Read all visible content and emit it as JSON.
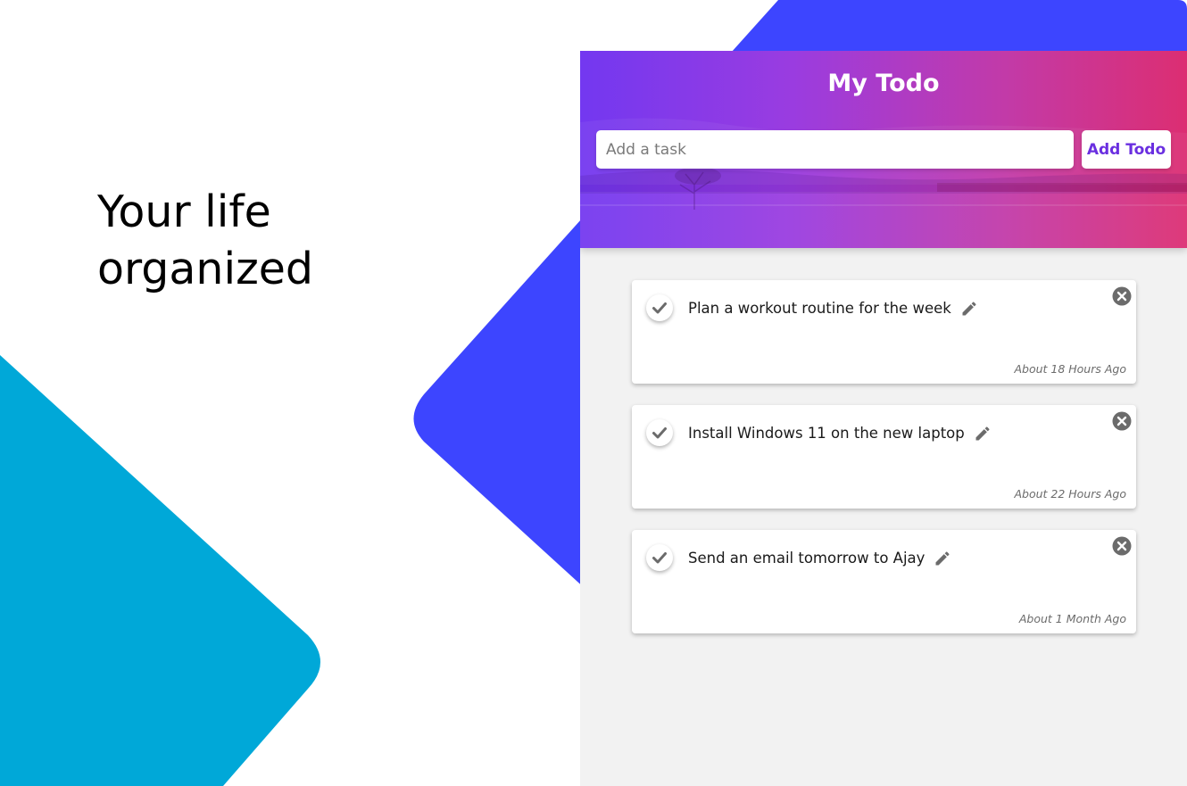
{
  "tagline": {
    "line1": "Your life",
    "line2": "organized"
  },
  "app": {
    "title": "My Todo",
    "input": {
      "value": "",
      "placeholder": "Add a task"
    },
    "add_button_label": "Add Todo",
    "todos": [
      {
        "text": "Plan a workout routine for the week",
        "time": "About 18 Hours Ago"
      },
      {
        "text": "Install Windows 11 on the new laptop",
        "time": "About 22 Hours Ago"
      },
      {
        "text": "Send an email tomorrow to Ajay",
        "time": "About 1 Month Ago"
      }
    ]
  },
  "colors": {
    "accent_blue": "#3d45ff",
    "accent_cyan": "#00a8d8",
    "header_gradient_start": "#7338f0",
    "header_gradient_end": "#dc2e72",
    "add_button_text": "#6a2fe0",
    "icon_gray": "#6b6b6b"
  },
  "icons": {
    "complete": "check-icon",
    "edit": "pencil-icon",
    "delete": "close-circle-icon"
  }
}
